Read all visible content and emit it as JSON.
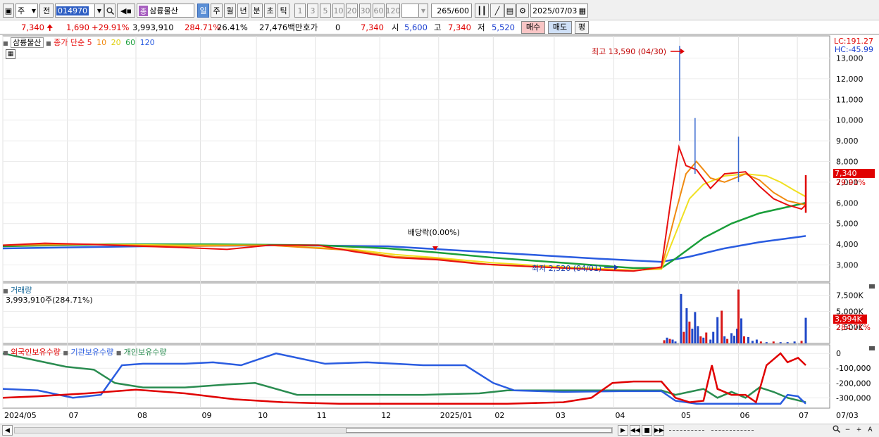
{
  "toolbar": {
    "period_type": "주",
    "prev_label": "전",
    "stock_code": "014970",
    "market_badge": "종",
    "stock_name": "삼륭물산",
    "timeframes": [
      "일",
      "주",
      "월",
      "년",
      "분",
      "초",
      "틱"
    ],
    "active_timeframe": "일",
    "intervals": [
      "1",
      "3",
      "5",
      "10",
      "20",
      "30",
      "60",
      "120"
    ],
    "count_display": "265",
    "count_total": "/600",
    "date_value": "2025/07/03"
  },
  "quote": {
    "price": "7,340",
    "change": "1,690",
    "change_pct": "+29.91%",
    "volume": "3,993,910",
    "volume_ratio": "284.71%",
    "turnover": "26.41%",
    "amount": "27,476백만",
    "hoga_label": "호가",
    "hoga_value": "0",
    "hoga_price": "7,340",
    "open_label": "시",
    "open_value": "5,600",
    "high_label": "고",
    "high_value": "7,340",
    "low_label": "저",
    "low_value": "5,520",
    "buy_label": "매수",
    "sell_label": "매도",
    "eval_label": "평"
  },
  "price_panel": {
    "stock_tag": "삼륭물산",
    "legend_prefix": "종가 단순",
    "ma": [
      {
        "period": "5",
        "color": "#e81010"
      },
      {
        "period": "10",
        "color": "#f08a10"
      },
      {
        "period": "20",
        "color": "#f0e020"
      },
      {
        "period": "60",
        "color": "#1a9e3a"
      },
      {
        "period": "120",
        "color": "#2a5ce0"
      }
    ],
    "lc_label": "LC:191.27",
    "hc_label": "HC:-45.99",
    "high_annotation": "최고 13,590 (04/30)",
    "low_annotation": "최저 2,520 (04/01)",
    "dividend_annotation": "배당락(0.00%)",
    "current_price_tag": "7,340",
    "current_pct_tag": "29.91%"
  },
  "volume_panel": {
    "title": "거래량",
    "value_label": "3,993,910주(284.71%)",
    "current_tag": "3,994K",
    "current_pct": "284.71%"
  },
  "holding_panel": {
    "legend": [
      {
        "name": "외국인보유수량",
        "color": "#e00000"
      },
      {
        "name": "기관보유수량",
        "color": "#2a5ce0"
      },
      {
        "name": "개인보유수량",
        "color": "#2a8c50"
      }
    ]
  },
  "chart_data": [
    {
      "type": "line",
      "title": "삼륭물산",
      "x_ticks": [
        "2024/05",
        "07",
        "08",
        "09",
        "10",
        "11",
        "12",
        "2025/01",
        "02",
        "03",
        "04",
        "05",
        "06",
        "07"
      ],
      "x_last_label": "07/03",
      "y_ticks": [
        3000,
        4000,
        5000,
        6000,
        7000,
        8000,
        9000,
        10000,
        11000,
        12000,
        13000
      ],
      "ylim": [
        2200,
        13900
      ],
      "series": [
        {
          "name": "5",
          "points": [
            [
              0,
              3950
            ],
            [
              60,
              4050
            ],
            [
              120,
              4000
            ],
            [
              200,
              3900
            ],
            [
              250,
              3850
            ],
            [
              320,
              3750
            ],
            [
              380,
              3950
            ],
            [
              450,
              3950
            ],
            [
              500,
              3650
            ],
            [
              560,
              3350
            ],
            [
              620,
              3250
            ],
            [
              680,
              3050
            ],
            [
              740,
              2950
            ],
            [
              800,
              2850
            ],
            [
              860,
              2750
            ],
            [
              900,
              2700
            ],
            [
              940,
              2900
            ],
            [
              955,
              6500
            ],
            [
              965,
              8700
            ],
            [
              975,
              7800
            ],
            [
              990,
              7600
            ],
            [
              1010,
              6700
            ],
            [
              1030,
              7400
            ],
            [
              1060,
              7500
            ],
            [
              1080,
              6800
            ],
            [
              1100,
              6200
            ],
            [
              1120,
              5900
            ],
            [
              1140,
              5700
            ],
            [
              1146,
              5900
            ]
          ]
        },
        {
          "name": "10",
          "points": [
            [
              0,
              3950
            ],
            [
              120,
              4000
            ],
            [
              250,
              3900
            ],
            [
              380,
              3950
            ],
            [
              500,
              3700
            ],
            [
              560,
              3400
            ],
            [
              620,
              3300
            ],
            [
              700,
              3000
            ],
            [
              800,
              2850
            ],
            [
              900,
              2720
            ],
            [
              940,
              2850
            ],
            [
              960,
              5500
            ],
            [
              975,
              7400
            ],
            [
              990,
              8000
            ],
            [
              1010,
              7200
            ],
            [
              1030,
              7000
            ],
            [
              1060,
              7400
            ],
            [
              1080,
              7100
            ],
            [
              1100,
              6500
            ],
            [
              1120,
              6100
            ],
            [
              1146,
              5900
            ]
          ]
        },
        {
          "name": "20",
          "points": [
            [
              0,
              3950
            ],
            [
              120,
              4000
            ],
            [
              250,
              3950
            ],
            [
              380,
              3950
            ],
            [
              500,
              3750
            ],
            [
              560,
              3500
            ],
            [
              620,
              3350
            ],
            [
              700,
              3100
            ],
            [
              800,
              2900
            ],
            [
              900,
              2750
            ],
            [
              940,
              2800
            ],
            [
              960,
              4500
            ],
            [
              980,
              6200
            ],
            [
              1000,
              6900
            ],
            [
              1030,
              7300
            ],
            [
              1060,
              7400
            ],
            [
              1090,
              7300
            ],
            [
              1110,
              7000
            ],
            [
              1130,
              6600
            ],
            [
              1146,
              6300
            ]
          ]
        },
        {
          "name": "60",
          "points": [
            [
              0,
              3900
            ],
            [
              150,
              4000
            ],
            [
              300,
              4000
            ],
            [
              450,
              3950
            ],
            [
              550,
              3800
            ],
            [
              620,
              3600
            ],
            [
              700,
              3350
            ],
            [
              800,
              3100
            ],
            [
              900,
              2850
            ],
            [
              940,
              2850
            ],
            [
              960,
              3300
            ],
            [
              1000,
              4300
            ],
            [
              1040,
              5000
            ],
            [
              1080,
              5500
            ],
            [
              1120,
              5800
            ],
            [
              1146,
              6000
            ]
          ]
        },
        {
          "name": "120",
          "points": [
            [
              0,
              3800
            ],
            [
              200,
              3900
            ],
            [
              400,
              3950
            ],
            [
              550,
              3900
            ],
            [
              650,
              3700
            ],
            [
              750,
              3500
            ],
            [
              850,
              3300
            ],
            [
              940,
              3150
            ],
            [
              980,
              3400
            ],
            [
              1030,
              3800
            ],
            [
              1080,
              4100
            ],
            [
              1146,
              4400
            ]
          ]
        }
      ]
    },
    {
      "type": "bar",
      "title": "거래량",
      "y_ticks_labels": [
        "2,500K",
        "5,000K",
        "7,500K"
      ],
      "ylim": [
        0,
        9000
      ],
      "bars": [
        [
          944,
          500
        ],
        [
          948,
          900
        ],
        [
          952,
          700
        ],
        [
          956,
          600
        ],
        [
          960,
          300
        ],
        [
          968,
          7700
        ],
        [
          972,
          1800
        ],
        [
          976,
          5500
        ],
        [
          980,
          3400
        ],
        [
          984,
          2300
        ],
        [
          988,
          4900
        ],
        [
          992,
          2700
        ],
        [
          996,
          1100
        ],
        [
          1000,
          900
        ],
        [
          1004,
          1700
        ],
        [
          1010,
          600
        ],
        [
          1014,
          1800
        ],
        [
          1020,
          4100
        ],
        [
          1026,
          5100
        ],
        [
          1030,
          1100
        ],
        [
          1034,
          700
        ],
        [
          1040,
          1600
        ],
        [
          1044,
          1200
        ],
        [
          1048,
          2300
        ],
        [
          1050,
          8400
        ],
        [
          1054,
          3900
        ],
        [
          1058,
          1100
        ],
        [
          1064,
          1000
        ],
        [
          1070,
          400
        ],
        [
          1076,
          600
        ],
        [
          1082,
          300
        ],
        [
          1090,
          200
        ],
        [
          1100,
          300
        ],
        [
          1110,
          200
        ],
        [
          1120,
          200
        ],
        [
          1130,
          300
        ],
        [
          1140,
          400
        ],
        [
          1146,
          3994
        ]
      ]
    },
    {
      "type": "line",
      "title": "보유수량",
      "y_ticks_labels": [
        "0",
        "-100,000",
        "-200,000",
        "-300,000"
      ],
      "ylim": [
        -370000,
        20000
      ],
      "series": [
        {
          "name": "외국인보유수량",
          "points": [
            [
              0,
              -300000
            ],
            [
              50,
              -290000
            ],
            [
              120,
              -270000
            ],
            [
              190,
              -245000
            ],
            [
              260,
              -270000
            ],
            [
              330,
              -310000
            ],
            [
              400,
              -330000
            ],
            [
              480,
              -340000
            ],
            [
              560,
              -340000
            ],
            [
              640,
              -340000
            ],
            [
              720,
              -340000
            ],
            [
              800,
              -330000
            ],
            [
              840,
              -300000
            ],
            [
              870,
              -200000
            ],
            [
              900,
              -190000
            ],
            [
              940,
              -190000
            ],
            [
              960,
              -300000
            ],
            [
              980,
              -330000
            ],
            [
              1000,
              -320000
            ],
            [
              1012,
              -80000
            ],
            [
              1020,
              -240000
            ],
            [
              1040,
              -280000
            ],
            [
              1060,
              -280000
            ],
            [
              1075,
              -330000
            ],
            [
              1090,
              -80000
            ],
            [
              1110,
              0
            ],
            [
              1120,
              -60000
            ],
            [
              1135,
              -30000
            ],
            [
              1146,
              -80000
            ]
          ]
        },
        {
          "name": "기관보유수량",
          "points": [
            [
              0,
              -240000
            ],
            [
              50,
              -250000
            ],
            [
              100,
              -300000
            ],
            [
              140,
              -280000
            ],
            [
              170,
              -80000
            ],
            [
              200,
              -70000
            ],
            [
              260,
              -70000
            ],
            [
              300,
              -60000
            ],
            [
              340,
              -80000
            ],
            [
              390,
              0
            ],
            [
              420,
              -30000
            ],
            [
              460,
              -70000
            ],
            [
              520,
              -60000
            ],
            [
              560,
              -70000
            ],
            [
              600,
              -80000
            ],
            [
              660,
              -80000
            ],
            [
              700,
              -200000
            ],
            [
              730,
              -250000
            ],
            [
              800,
              -260000
            ],
            [
              880,
              -255000
            ],
            [
              940,
              -255000
            ],
            [
              960,
              -320000
            ],
            [
              990,
              -340000
            ],
            [
              1040,
              -340000
            ],
            [
              1080,
              -340000
            ],
            [
              1110,
              -340000
            ],
            [
              1120,
              -280000
            ],
            [
              1135,
              -290000
            ],
            [
              1146,
              -340000
            ]
          ]
        },
        {
          "name": "개인보유수량",
          "points": [
            [
              0,
              0
            ],
            [
              40,
              -40000
            ],
            [
              90,
              -90000
            ],
            [
              130,
              -110000
            ],
            [
              160,
              -200000
            ],
            [
              200,
              -230000
            ],
            [
              260,
              -230000
            ],
            [
              320,
              -210000
            ],
            [
              360,
              -200000
            ],
            [
              420,
              -280000
            ],
            [
              500,
              -280000
            ],
            [
              600,
              -280000
            ],
            [
              680,
              -270000
            ],
            [
              720,
              -250000
            ],
            [
              800,
              -250000
            ],
            [
              880,
              -250000
            ],
            [
              940,
              -250000
            ],
            [
              960,
              -280000
            ],
            [
              980,
              -260000
            ],
            [
              1000,
              -240000
            ],
            [
              1020,
              -300000
            ],
            [
              1040,
              -260000
            ],
            [
              1060,
              -300000
            ],
            [
              1080,
              -230000
            ],
            [
              1100,
              -260000
            ],
            [
              1120,
              -300000
            ],
            [
              1146,
              -330000
            ]
          ]
        }
      ]
    }
  ]
}
